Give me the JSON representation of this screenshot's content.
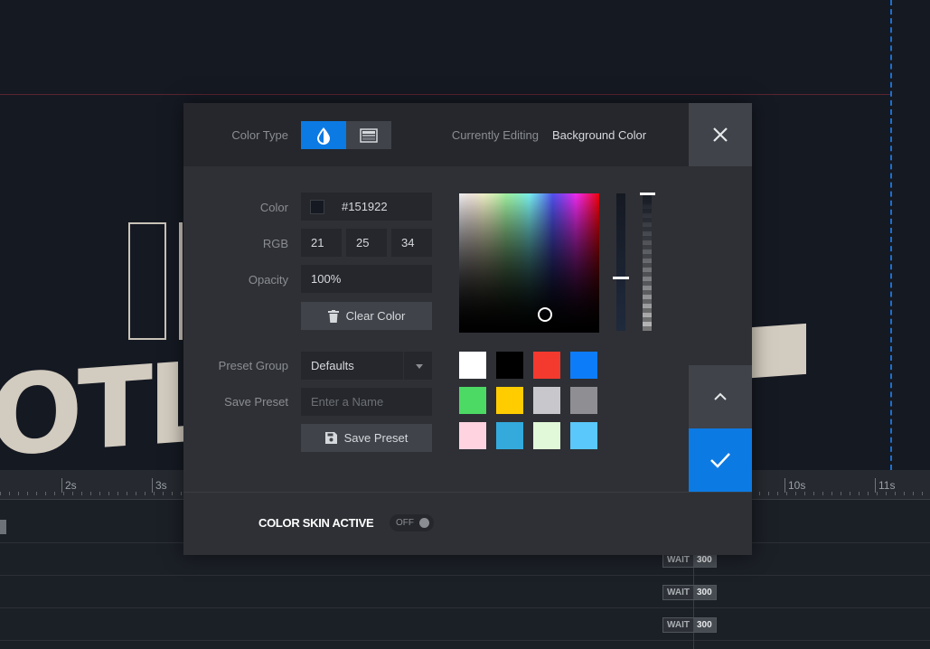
{
  "background": {
    "big_text": "OTL"
  },
  "timeline": {
    "ruler_labels": [
      "2s",
      "3s",
      "10s",
      "11s"
    ],
    "wait_label": "WAIT",
    "wait_values": [
      "300",
      "300",
      "300"
    ]
  },
  "modal": {
    "header": {
      "color_type_label": "Color Type",
      "currently_editing_label": "Currently Editing",
      "currently_editing_value": "Background Color"
    },
    "form": {
      "color_label": "Color",
      "color_hex": "#151922",
      "rgb_label": "RGB",
      "rgb": [
        "21",
        "25",
        "34"
      ],
      "opacity_label": "Opacity",
      "opacity_value": "100%",
      "clear_button": "Clear Color",
      "preset_group_label": "Preset Group",
      "preset_group_value": "Defaults",
      "save_preset_label": "Save Preset",
      "name_placeholder": "Enter a Name",
      "save_preset_button": "Save Preset"
    },
    "presets": [
      "#ffffff",
      "#000000",
      "#f4392f",
      "#0d7cf9",
      "#4cd964",
      "#ffcc00",
      "#c8c7cc",
      "#8e8e93",
      "#ffd3e0",
      "#34aadc",
      "#e1f9d8",
      "#5ac8fa"
    ],
    "footer": {
      "skin_label": "COLOR SKIN ACTIVE",
      "toggle_text": "OFF"
    }
  },
  "colors": {
    "accent": "#0c7ae3",
    "canvas_bg": "#151922"
  }
}
